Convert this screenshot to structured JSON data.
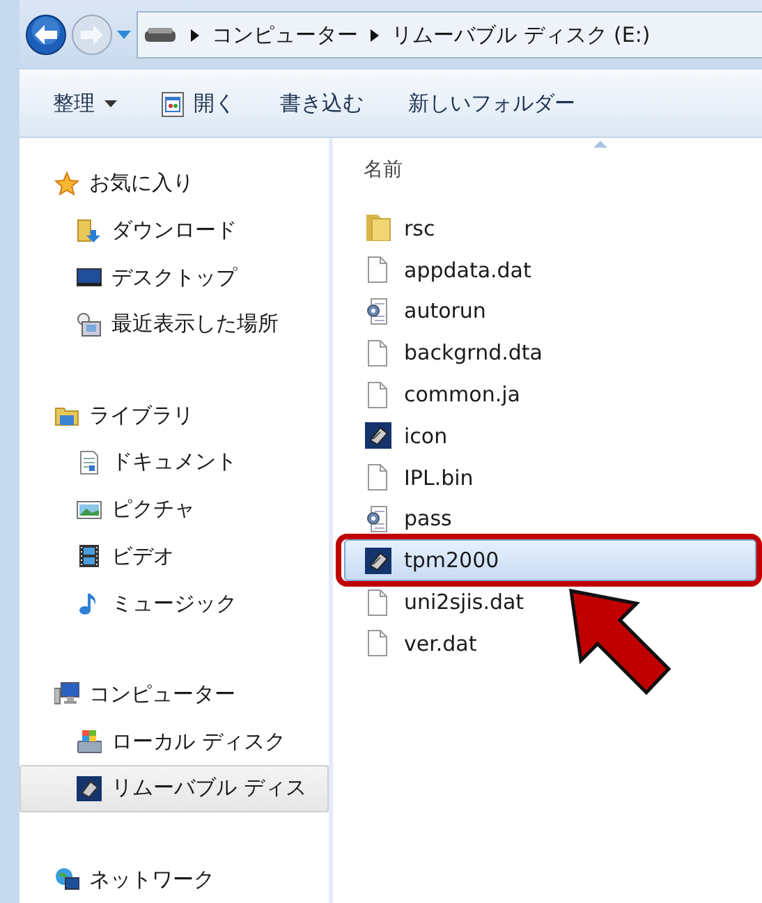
{
  "address": {
    "crumbs": [
      "コンピューター",
      "リムーバブル ディスク (E:)"
    ]
  },
  "toolbar": [
    {
      "label": "整理",
      "kind": "menu"
    },
    {
      "label": "開く",
      "kind": "open"
    },
    {
      "label": "書き込む",
      "kind": "plain"
    },
    {
      "label": "新しいフォルダー",
      "kind": "plain"
    }
  ],
  "navigation": [
    {
      "label": "お気に入り",
      "kind": "favorites",
      "selected": false,
      "children": [
        {
          "label": "ダウンロード",
          "kind": "downloads",
          "selected": false
        },
        {
          "label": "デスクトップ",
          "kind": "desktop",
          "selected": false
        },
        {
          "label": "最近表示した場所",
          "kind": "recent",
          "selected": false
        }
      ]
    },
    {
      "label": "ライブラリ",
      "kind": "library",
      "selected": false,
      "children": [
        {
          "label": "ドキュメント",
          "kind": "documents",
          "selected": false
        },
        {
          "label": "ピクチャ",
          "kind": "pictures",
          "selected": false
        },
        {
          "label": "ビデオ",
          "kind": "videos",
          "selected": false
        },
        {
          "label": "ミュージック",
          "kind": "music",
          "selected": false
        }
      ]
    },
    {
      "label": "コンピューター",
      "kind": "computer",
      "selected": false,
      "children": [
        {
          "label": "ローカル ディスク",
          "kind": "disk",
          "selected": false
        },
        {
          "label": "リムーバブル ディス",
          "kind": "removable",
          "selected": true
        }
      ]
    },
    {
      "label": "ネットワーク",
      "kind": "network",
      "selected": false
    }
  ],
  "files": {
    "column": "名前",
    "items": [
      {
        "name": "rsc",
        "kind": "folder",
        "selected": false,
        "callout": false
      },
      {
        "name": "appdata.dat",
        "kind": "file",
        "selected": false,
        "callout": false
      },
      {
        "name": "autorun",
        "kind": "settings",
        "selected": false,
        "callout": false
      },
      {
        "name": "backgrnd.dta",
        "kind": "file",
        "selected": false,
        "callout": false
      },
      {
        "name": "common.ja",
        "kind": "file",
        "selected": false,
        "callout": false
      },
      {
        "name": "icon",
        "kind": "app",
        "selected": false,
        "callout": false
      },
      {
        "name": "IPL.bin",
        "kind": "file",
        "selected": false,
        "callout": false
      },
      {
        "name": "pass",
        "kind": "settings",
        "selected": false,
        "callout": false
      },
      {
        "name": "tpm2000",
        "kind": "app",
        "selected": true,
        "callout": true
      },
      {
        "name": "uni2sjis.dat",
        "kind": "file",
        "selected": false,
        "callout": false
      },
      {
        "name": "ver.dat",
        "kind": "file",
        "selected": false,
        "callout": false
      }
    ]
  }
}
